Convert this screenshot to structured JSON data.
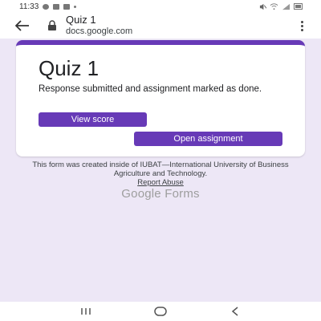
{
  "status_bar": {
    "time": "11:33",
    "right_icons": [
      "mute-icon",
      "wifi-icon",
      "signal-icon",
      "battery-icon"
    ]
  },
  "browser": {
    "title": "Quiz 1",
    "url": "docs.google.com",
    "icons": {
      "back": "back-arrow-icon",
      "lock": "lock-icon",
      "menu": "overflow-menu-icon"
    }
  },
  "card": {
    "quiz_title": "Quiz 1",
    "message": "Response submitted and assignment marked as done.",
    "view_score_label": "View score",
    "open_assignment_label": "Open assignment",
    "accent_color": "#673ab7"
  },
  "footer": {
    "notice": "This form was created inside of IUBAT—International University of Business Agriculture and Technology.",
    "report_link": "Report Abuse",
    "logo_text": "Google Forms"
  },
  "nav_bar": {
    "icons": [
      "recents-icon",
      "home-icon",
      "back-icon"
    ]
  }
}
